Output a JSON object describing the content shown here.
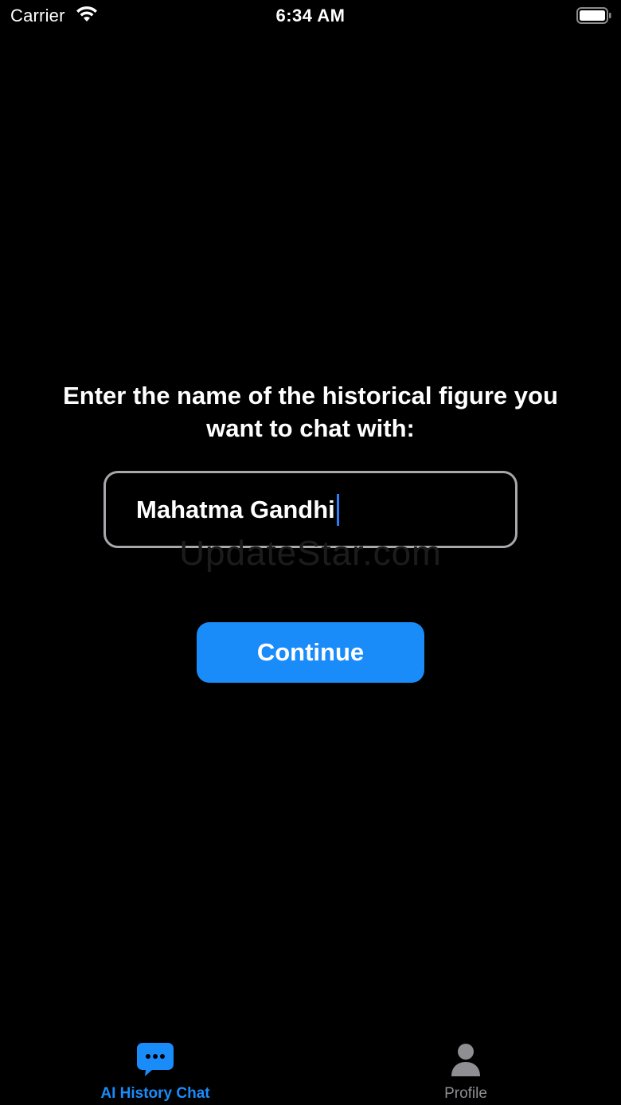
{
  "status_bar": {
    "carrier": "Carrier",
    "time": "6:34 AM"
  },
  "main": {
    "prompt": "Enter the name of the historical figure you want to chat with:",
    "name_input_value": "Mahatma Gandhi",
    "continue_label": "Continue",
    "watermark": "UpdateStar.com"
  },
  "tab_bar": {
    "items": [
      {
        "label": "AI History Chat",
        "icon": "chat-bubble-icon",
        "active": true
      },
      {
        "label": "Profile",
        "icon": "person-icon",
        "active": false
      }
    ]
  },
  "colors": {
    "accent": "#1a8cfa",
    "background": "#000000",
    "inactive_tab": "#8e8e93",
    "field_border": "#a7a7ac"
  }
}
